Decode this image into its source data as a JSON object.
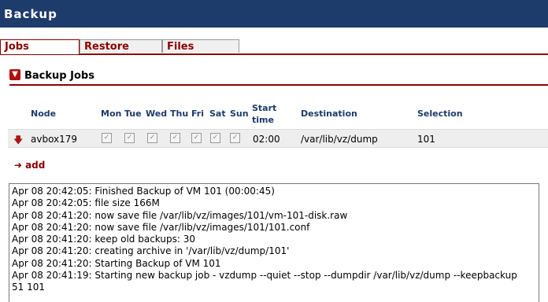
{
  "window": {
    "title": "Backup"
  },
  "tabs": [
    {
      "label": "Jobs",
      "active": true
    },
    {
      "label": "Restore",
      "active": false
    },
    {
      "label": "Files",
      "active": false
    }
  ],
  "section": {
    "title": "Backup Jobs",
    "icon": "down-arrow-icon"
  },
  "table": {
    "headers": {
      "node": "Node",
      "days": [
        "Mon",
        "Tue",
        "Wed",
        "Thu",
        "Fri",
        "Sat",
        "Sun"
      ],
      "start_time_1": "Start",
      "start_time_2": "time",
      "destination": "Destination",
      "selection": "Selection"
    },
    "rows": [
      {
        "node": "avbox179",
        "days_checked": [
          true,
          true,
          true,
          true,
          true,
          true,
          true
        ],
        "start_time": "02:00",
        "destination": "/var/lib/vz/dump",
        "selection": "101"
      }
    ]
  },
  "add_label": "add",
  "log": {
    "lines": [
      "Apr 08 20:42:05: Finished Backup of VM 101 (00:00:45)",
      "Apr 08 20:42:05: file size 166M",
      "Apr 08 20:41:20: now save file /var/lib/vz/images/101/vm-101-disk.raw",
      "Apr 08 20:41:20: now save file /var/lib/vz/images/101/101.conf",
      "Apr 08 20:41:20: keep old backups: 30",
      "Apr 08 20:41:20: creating archive in '/var/lib/vz/dump/101'",
      "Apr 08 20:41:20: Starting Backup of VM 101",
      "Apr 08 20:41:19: Starting new backup job - vzdump --quiet --stop --dumpdir /var/lib/vz/dump --keepbackup",
      "51 101"
    ]
  },
  "colors": {
    "title_bg": "#1d3b6b",
    "accent": "#8b0000",
    "header_text": "#1d3b6b"
  }
}
